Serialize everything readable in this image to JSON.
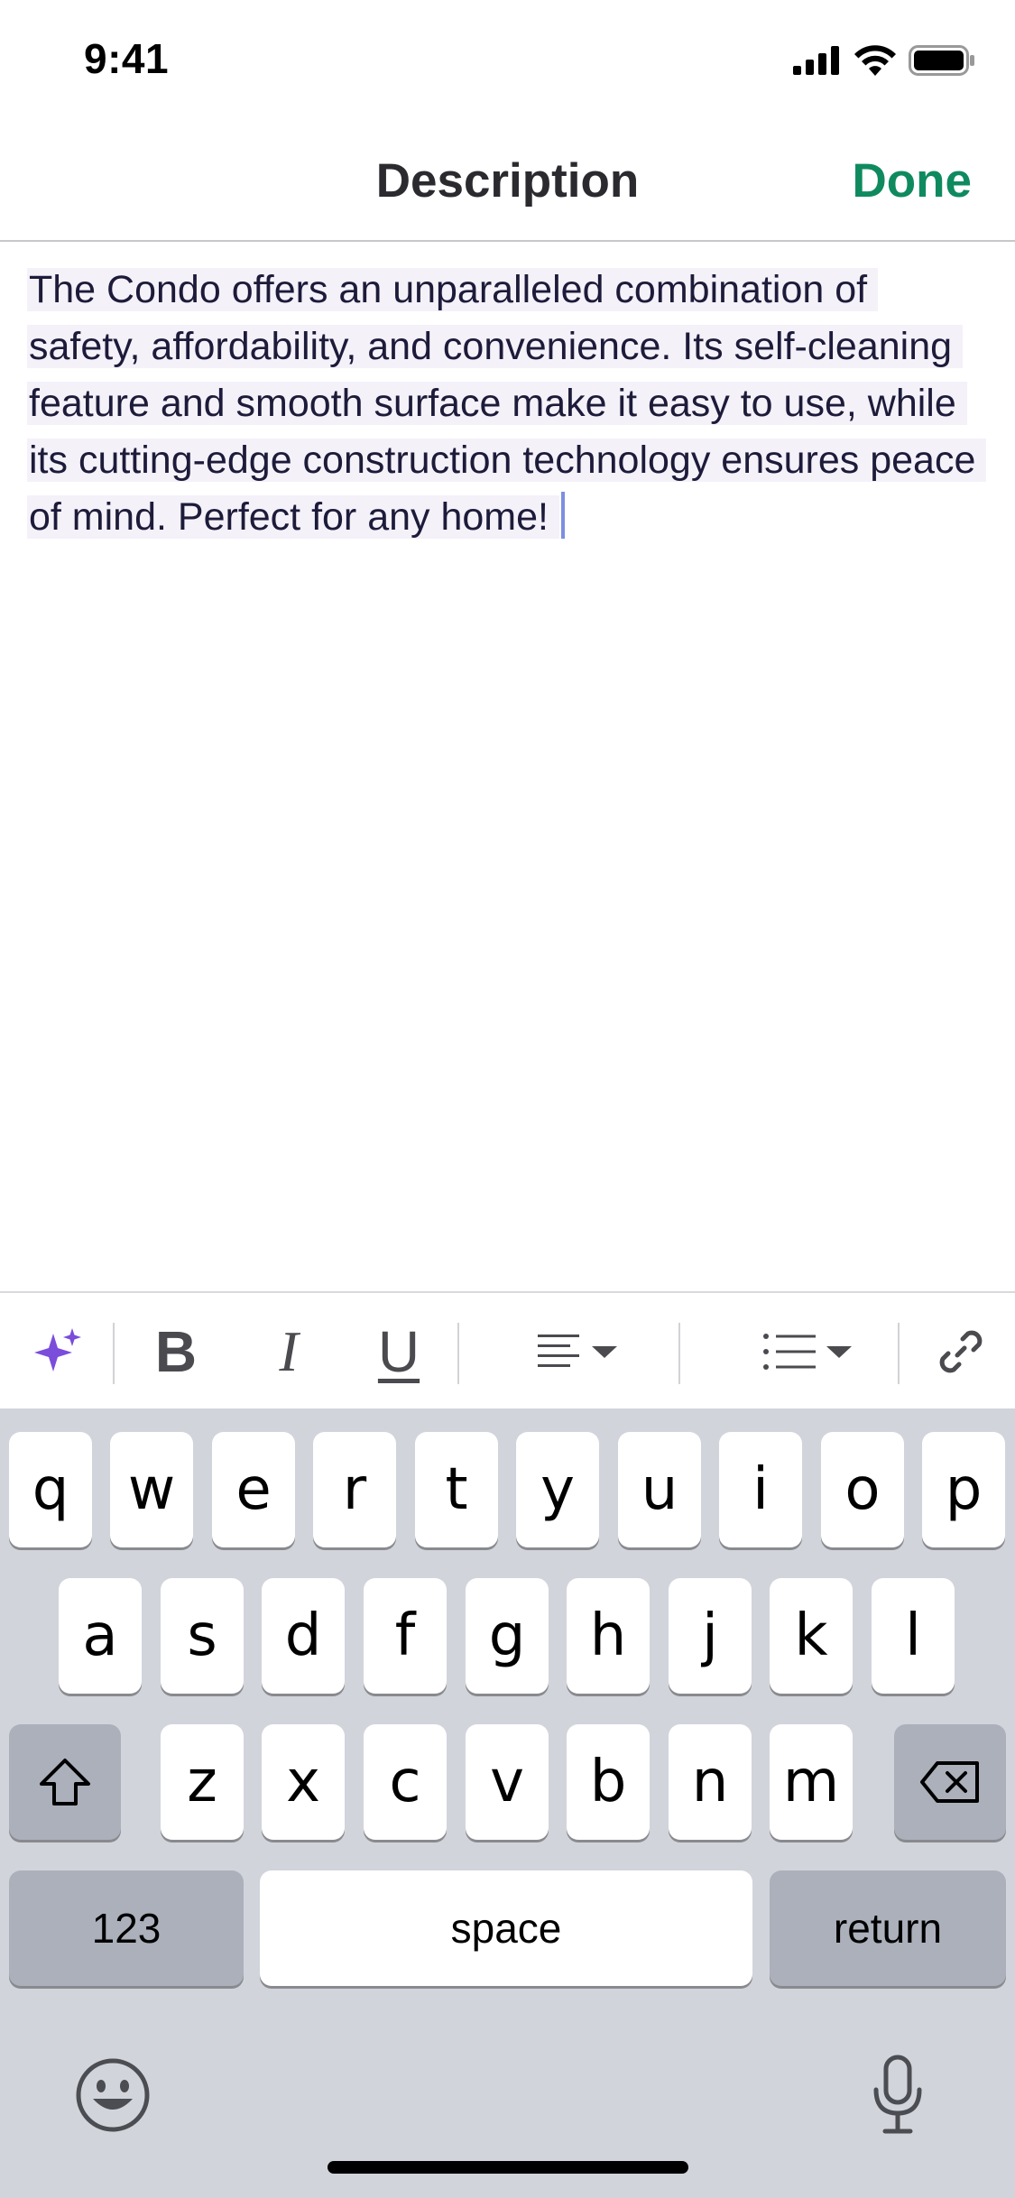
{
  "status_bar": {
    "time": "9:41"
  },
  "nav": {
    "title": "Description",
    "done_label": "Done"
  },
  "editor": {
    "text": "The Condo offers an unparalleled combination of safety, affordability, and convenience. Its self-cleaning feature and smooth surface make it easy to use, while its cutting-edge construction technology ensures peace of mind. Perfect for any home!"
  },
  "toolbar": {
    "ai_icon": "sparkles-icon",
    "bold_label": "B",
    "italic_label": "I",
    "underline_label": "U",
    "align_icon": "align-left-icon",
    "list_icon": "bullet-list-icon",
    "link_icon": "link-icon",
    "ai_color": "#7b4ddb"
  },
  "keyboard": {
    "row1": [
      "q",
      "w",
      "e",
      "r",
      "t",
      "y",
      "u",
      "i",
      "o",
      "p"
    ],
    "row2": [
      "a",
      "s",
      "d",
      "f",
      "g",
      "h",
      "j",
      "k",
      "l"
    ],
    "row3": [
      "z",
      "x",
      "c",
      "v",
      "b",
      "n",
      "m"
    ],
    "numbers_label": "123",
    "space_label": "space",
    "return_label": "return",
    "emoji_icon": "emoji-icon",
    "mic_icon": "microphone-icon"
  },
  "colors": {
    "accent": "#0f8a5f",
    "highlight": "#f4f1f9"
  }
}
